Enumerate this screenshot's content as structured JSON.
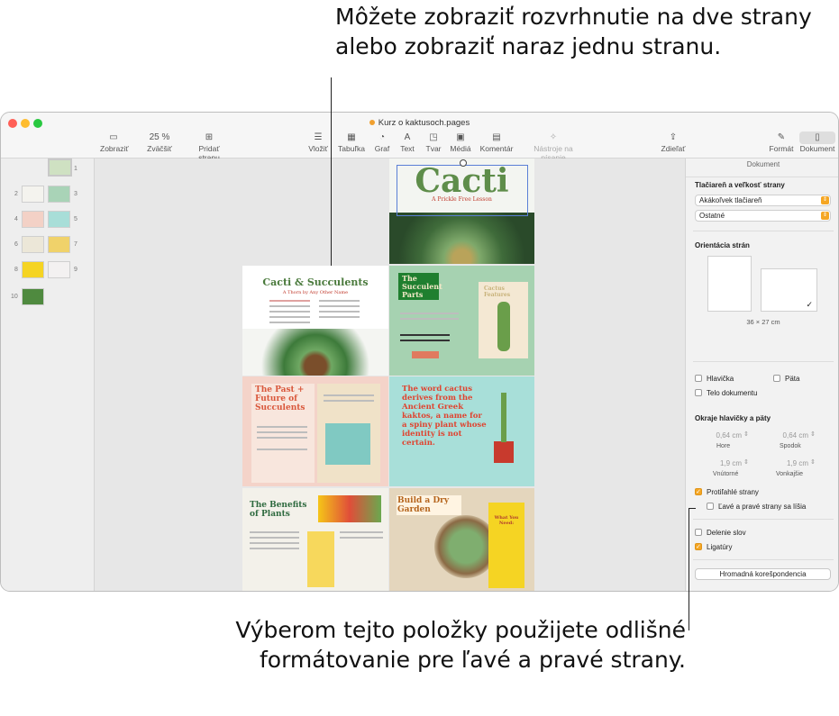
{
  "callouts": {
    "top": "Môžete zobraziť rozvrhnutie na dve strany alebo zobraziť naraz jednu stranu.",
    "bottom": "Výberom tejto položky použijete odlišné formátovanie pre ľavé a pravé strany."
  },
  "window": {
    "title": "Kurz o kaktusoch.pages",
    "traffic_colors": [
      "#ff5f57",
      "#febc2e",
      "#28c840"
    ]
  },
  "toolbar": {
    "view": "Zobraziť",
    "zoom_value": "25 %",
    "zoom": "Zväčšiť",
    "add_page": "Pridať stranu",
    "insert": "Vložiť",
    "table": "Tabuľka",
    "chart": "Graf",
    "text": "Text",
    "shape": "Tvar",
    "media": "Médiá",
    "comment": "Komentár",
    "writing_tools": "Nástroje na písanie",
    "share": "Zdieľať",
    "format": "Formát",
    "document": "Dokument"
  },
  "thumbnails": {
    "page_numbers": [
      "1",
      "2",
      "3",
      "4",
      "5",
      "6",
      "7",
      "8",
      "9",
      "10"
    ]
  },
  "pages": {
    "cover_title": "Cacti",
    "cover_subtitle": "A Prickle Free Lesson",
    "p2_title": "Cacti & Succulents",
    "p2_subtitle": "A Thorn by Any Other Name",
    "p3_title": "The Succulent Parts",
    "p3_side": "Cactus Features",
    "p4_title": "The Past + Future of Succulents",
    "p5_title": "The word cactus derives from the Ancient Greek kaktos, a name for a spiny plant whose identity is not certain.",
    "p6_title": "The Benefits of Plants",
    "p7_title": "Build a Dry Garden",
    "p7_card": "What You Need:"
  },
  "inspector": {
    "header": "Dokument",
    "printer_section": "Tlačiareň a veľkosť strany",
    "printer": "Akákoľvek tlačiareň",
    "paper": "Ostatné",
    "orientation_section": "Orientácia strán",
    "page_size": "36 × 27 cm",
    "header_cb": "Hlavička",
    "footer_cb": "Päta",
    "body_cb": "Telo dokumentu",
    "margins_section": "Okraje hlavičky a päty",
    "top_val": "0,64 cm",
    "top_lbl": "Hore",
    "bottom_val": "0,64 cm",
    "bottom_lbl": "Spodok",
    "inside_val": "1,9 cm",
    "inside_lbl": "Vnútorné",
    "outside_val": "1,9 cm",
    "outside_lbl": "Vonkajšie",
    "facing_pages": "Protiľahlé strany",
    "left_right_differ": "Ľavé a pravé strany sa líšia",
    "hyphenation": "Delenie slov",
    "ligatures": "Ligatúry",
    "mail_merge": "Hromadná korešpondencia"
  }
}
